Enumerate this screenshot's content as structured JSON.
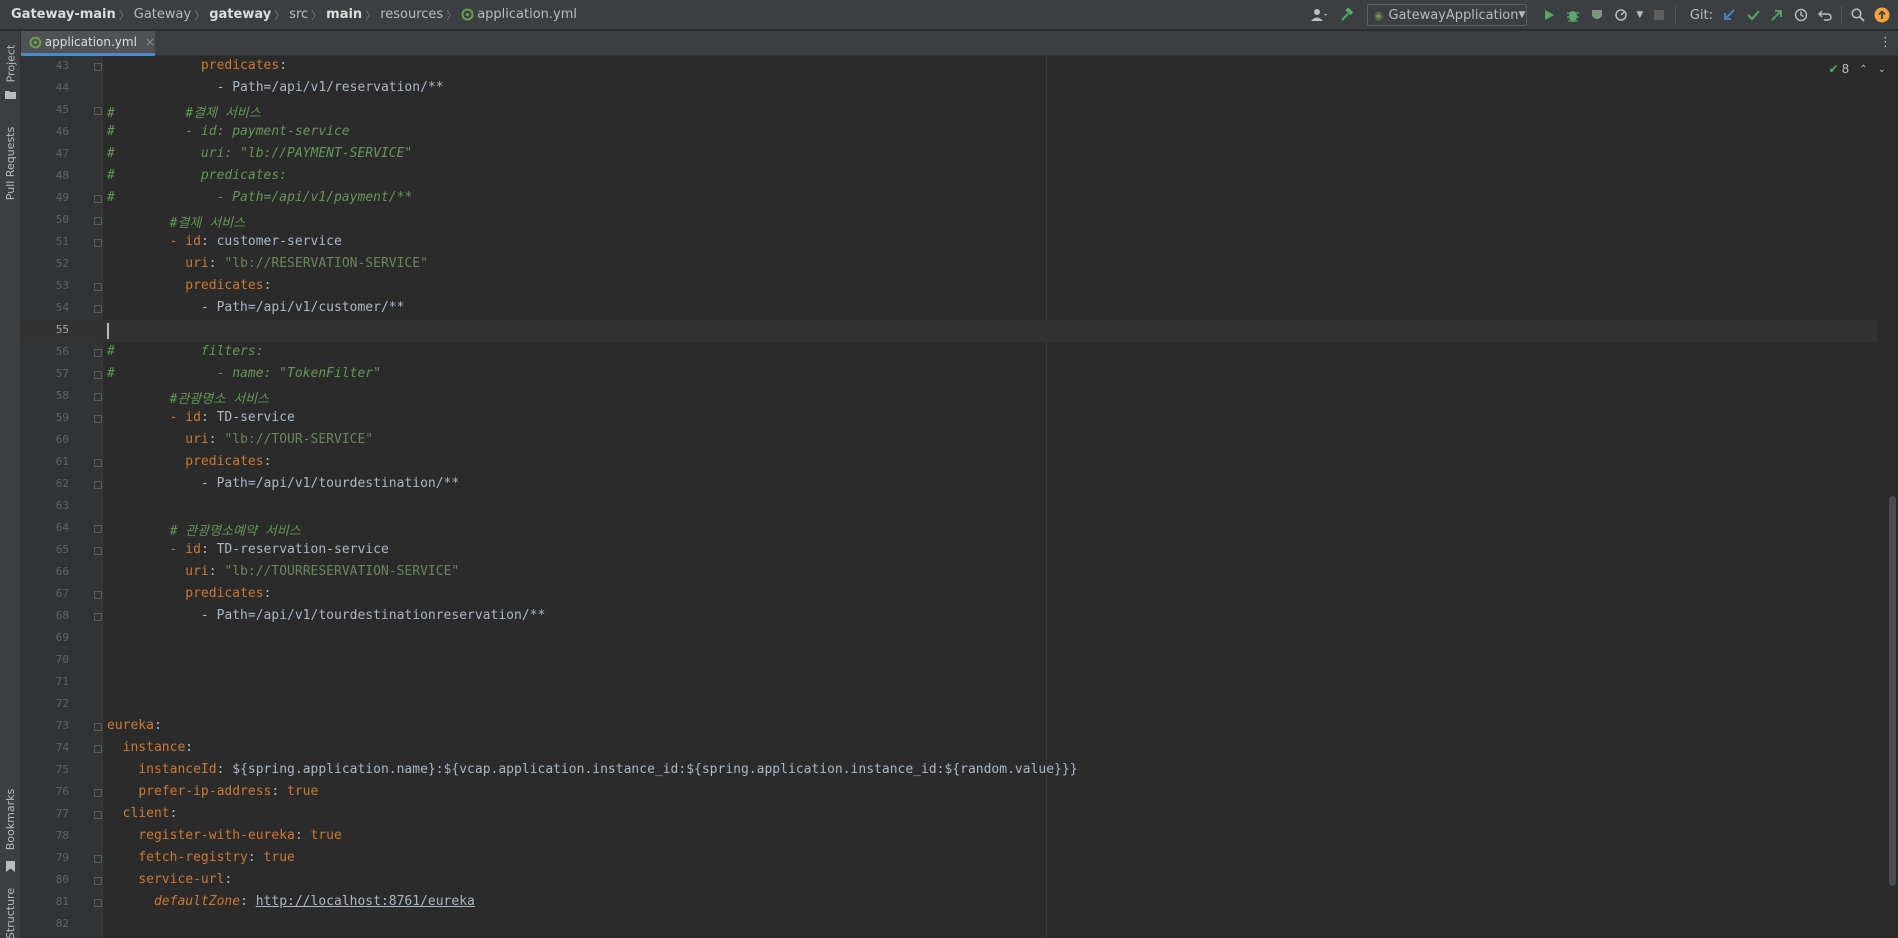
{
  "breadcrumb": [
    "Gateway-main",
    "Gateway",
    "gateway",
    "src",
    "main",
    "resources",
    "application.yml"
  ],
  "toolbar": {
    "run_config": "GatewayApplication",
    "git_label": "Git:"
  },
  "left_tabs": {
    "project": "Project",
    "pull_requests": "Pull Requests",
    "bookmarks": "Bookmarks",
    "structure": "Structure"
  },
  "editor_tab": {
    "label": "application.yml"
  },
  "inspection": {
    "count": "8"
  },
  "colors": {
    "accent": "#4a88c7",
    "key": "#cc7832",
    "string": "#6a8759",
    "comment": "#629755",
    "background": "#2b2b2b"
  },
  "lines": [
    {
      "n": "43",
      "t": "            predicates:"
    },
    {
      "n": "44",
      "t": "              - Path=/api/v1/reservation/**"
    },
    {
      "n": "45",
      "t": "#         #결제 서비스"
    },
    {
      "n": "46",
      "t": "#         - id: payment-service"
    },
    {
      "n": "47",
      "t": "#           uri: \"lb://PAYMENT-SERVICE\""
    },
    {
      "n": "48",
      "t": "#           predicates:"
    },
    {
      "n": "49",
      "t": "#             - Path=/api/v1/payment/**"
    },
    {
      "n": "50",
      "t": "        #결제 서비스"
    },
    {
      "n": "51",
      "t": "        - id: customer-service"
    },
    {
      "n": "52",
      "t": "          uri: \"lb://RESERVATION-SERVICE\""
    },
    {
      "n": "53",
      "t": "          predicates:"
    },
    {
      "n": "54",
      "t": "            - Path=/api/v1/customer/**"
    },
    {
      "n": "55",
      "t": ""
    },
    {
      "n": "56",
      "t": "#           filters:"
    },
    {
      "n": "57",
      "t": "#             - name: \"TokenFilter\""
    },
    {
      "n": "58",
      "t": "        #관광명소 서비스"
    },
    {
      "n": "59",
      "t": "        - id: TD-service"
    },
    {
      "n": "60",
      "t": "          uri: \"lb://TOUR-SERVICE\""
    },
    {
      "n": "61",
      "t": "          predicates:"
    },
    {
      "n": "62",
      "t": "            - Path=/api/v1/tourdestination/**"
    },
    {
      "n": "63",
      "t": ""
    },
    {
      "n": "64",
      "t": "        # 관광명소예약 서비스"
    },
    {
      "n": "65",
      "t": "        - id: TD-reservation-service"
    },
    {
      "n": "66",
      "t": "          uri: \"lb://TOURRESERVATION-SERVICE\""
    },
    {
      "n": "67",
      "t": "          predicates:"
    },
    {
      "n": "68",
      "t": "            - Path=/api/v1/tourdestinationreservation/**"
    },
    {
      "n": "69",
      "t": ""
    },
    {
      "n": "70",
      "t": ""
    },
    {
      "n": "71",
      "t": ""
    },
    {
      "n": "72",
      "t": ""
    },
    {
      "n": "73",
      "t": "eureka:"
    },
    {
      "n": "74",
      "t": "  instance:"
    },
    {
      "n": "75",
      "t": "    instanceId: ${spring.application.name}:${vcap.application.instance_id:${spring.application.instance_id:${random.value}}}"
    },
    {
      "n": "76",
      "t": "    prefer-ip-address: true"
    },
    {
      "n": "77",
      "t": "  client:"
    },
    {
      "n": "78",
      "t": "    register-with-eureka: true"
    },
    {
      "n": "79",
      "t": "    fetch-registry: true"
    },
    {
      "n": "80",
      "t": "    service-url:"
    },
    {
      "n": "81",
      "t": "      defaultZone: http://localhost:8761/eureka"
    },
    {
      "n": "82",
      "t": ""
    }
  ]
}
